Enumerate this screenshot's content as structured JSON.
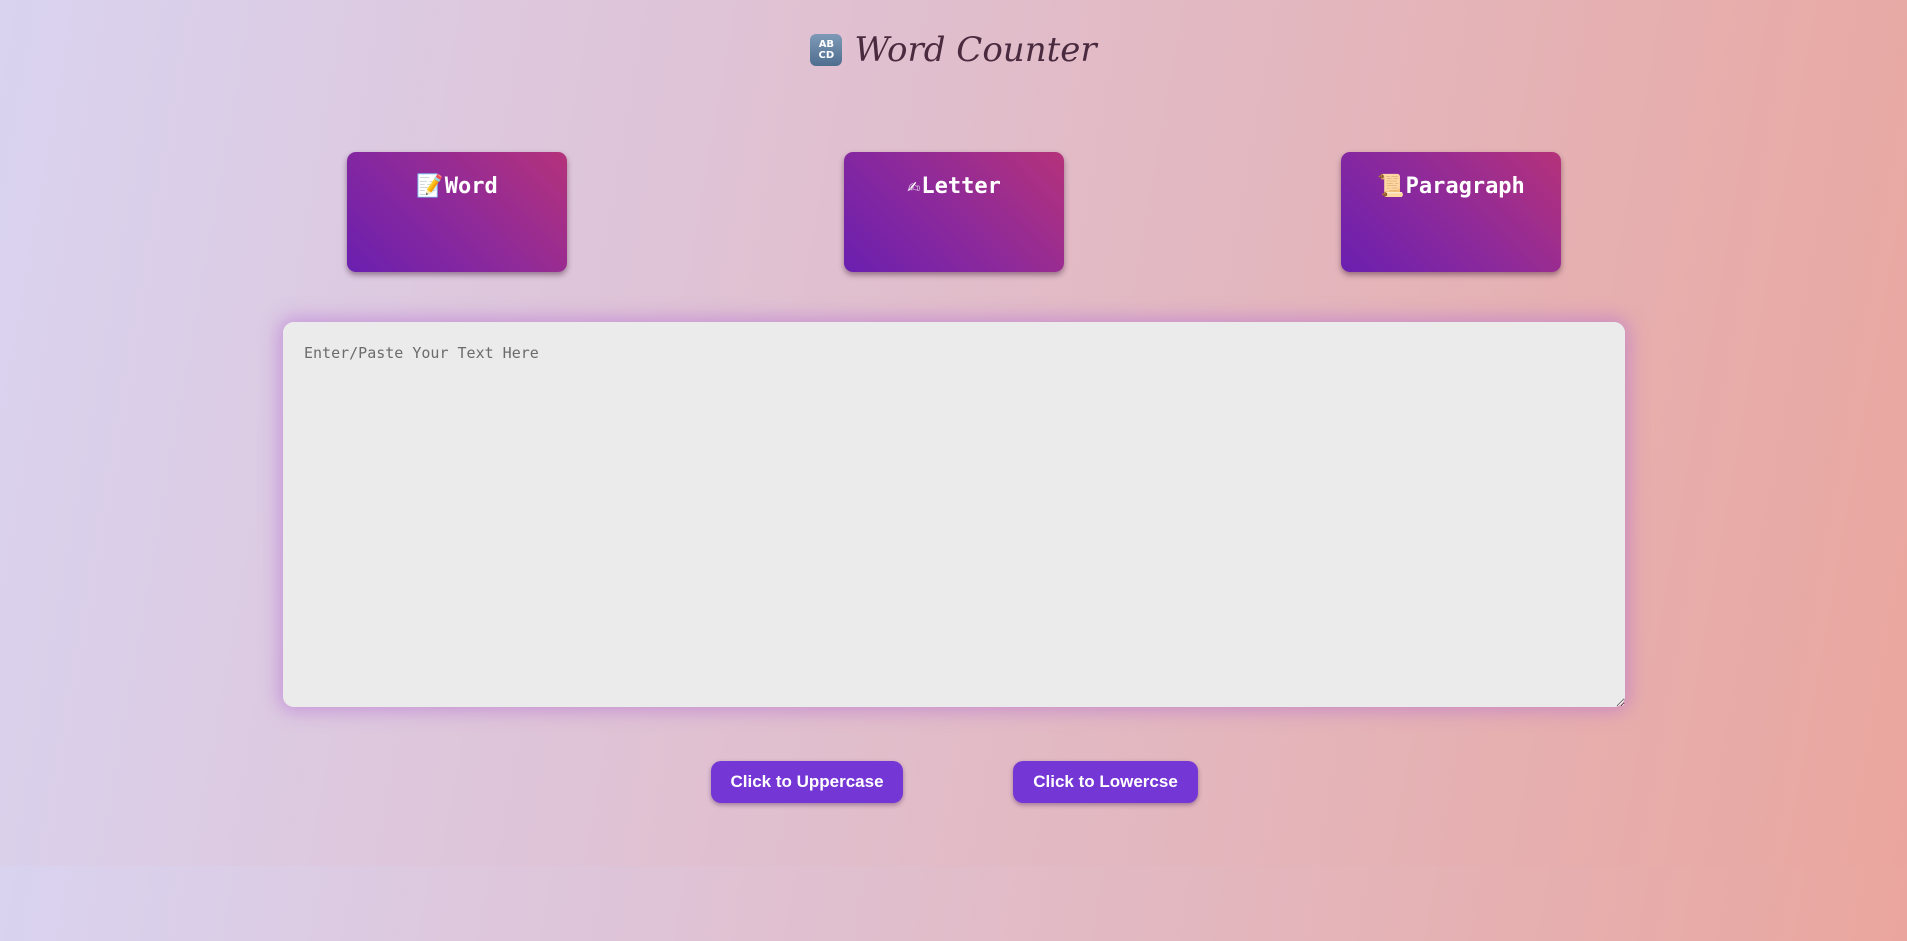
{
  "header": {
    "icon": "abcd-input-icon",
    "icon_top": "AB",
    "icon_bottom": "CD",
    "title": "Word Counter"
  },
  "cards": {
    "word": {
      "icon": "memo-icon",
      "emoji": "📝",
      "label": "Word"
    },
    "letter": {
      "icon": "writing-hand-icon",
      "emoji": "✍",
      "label": "Letter"
    },
    "paragraph": {
      "icon": "scroll-icon",
      "emoji": "📜",
      "label": "Paragraph"
    }
  },
  "editor": {
    "placeholder": "Enter/Paste Your Text Here",
    "value": ""
  },
  "actions": {
    "uppercase_label": "Click to Uppercase",
    "lowercase_label": "Click to Lowercse"
  },
  "colors": {
    "card_gradient_start": "#6a1fb0",
    "card_gradient_end": "#b5327a",
    "button": "#7536d6",
    "editor_bg": "#ebebeb"
  }
}
